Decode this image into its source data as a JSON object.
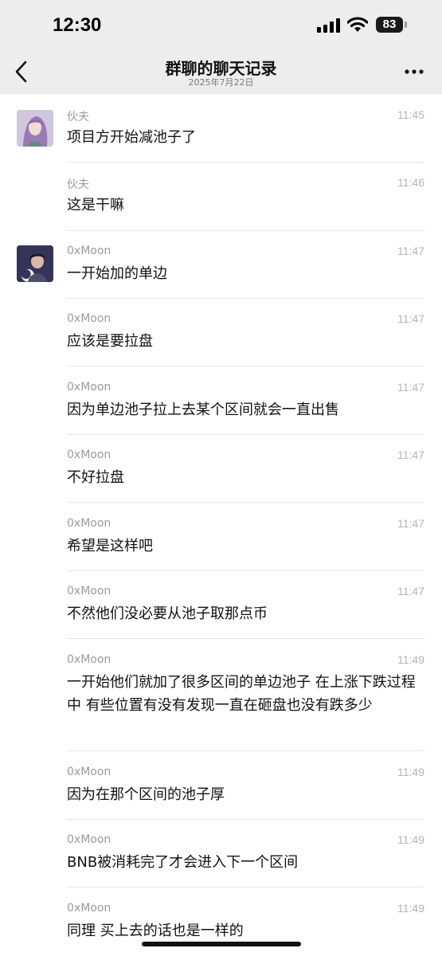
{
  "status_bar": {
    "time": "12:30",
    "battery": "83"
  },
  "header": {
    "title": "群聊的聊天记录",
    "subtitle": "2025年7月22日"
  },
  "messages": [
    {
      "sender": "伙夫",
      "time": "11:45",
      "text": "项目方开始减池子了",
      "avatar": true
    },
    {
      "sender": "伙夫",
      "time": "11:46",
      "text": "这是干嘛",
      "avatar": false
    },
    {
      "sender": "0xMoon",
      "time": "11:47",
      "text": "一开始加的单边",
      "avatar": true
    },
    {
      "sender": "0xMoon",
      "time": "11:47",
      "text": "应该是要拉盘",
      "avatar": false
    },
    {
      "sender": "0xMoon",
      "time": "11:47",
      "text": "因为单边池子拉上去某个区间就会一直出售",
      "avatar": false
    },
    {
      "sender": "0xMoon",
      "time": "11:47",
      "text": "不好拉盘",
      "avatar": false
    },
    {
      "sender": "0xMoon",
      "time": "11:47",
      "text": "希望是这样吧",
      "avatar": false
    },
    {
      "sender": "0xMoon",
      "time": "11:47",
      "text": "不然他们没必要从池子取那点币",
      "avatar": false
    },
    {
      "sender": "0xMoon",
      "time": "11:49",
      "text": "一开始他们就加了很多区间的单边池子 在上涨下跌过程中 有些位置有没有发现一直在砸盘也没有跌多少",
      "avatar": false
    },
    {
      "sender": "0xMoon",
      "time": "11:49",
      "text": "因为在那个区间的池子厚",
      "avatar": false
    },
    {
      "sender": "0xMoon",
      "time": "11:49",
      "text": "BNB被消耗完了才会进入下一个区间",
      "avatar": false
    },
    {
      "sender": "0xMoon",
      "time": "11:49",
      "text": "同理 买上去的话也是一样的",
      "avatar": false
    }
  ]
}
